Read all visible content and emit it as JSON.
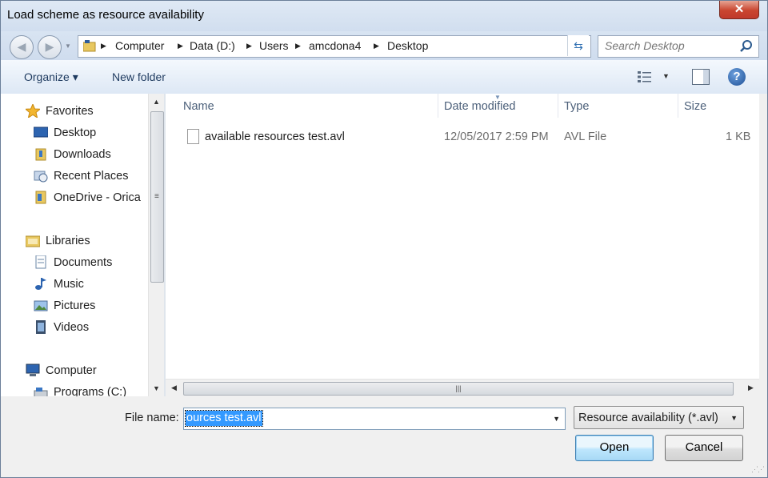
{
  "window": {
    "title": "Load scheme as resource availability",
    "close_glyph": "✕"
  },
  "navigation": {
    "back_glyph": "◀",
    "forward_glyph": "▶"
  },
  "address": {
    "breadcrumb": [
      "Computer",
      "Data (D:)",
      "Users",
      "amcdona4",
      "Desktop"
    ]
  },
  "search": {
    "placeholder": "Search Desktop"
  },
  "toolbar": {
    "organize_label": "Organize ▾",
    "new_folder_label": "New folder",
    "help_glyph": "?"
  },
  "nav_pane": {
    "favorites": {
      "label": "Favorites",
      "items": [
        "Desktop",
        "Downloads",
        "Recent Places",
        "OneDrive - Orica"
      ]
    },
    "libraries": {
      "label": "Libraries",
      "items": [
        "Documents",
        "Music",
        "Pictures",
        "Videos"
      ]
    },
    "computer": {
      "label": "Computer",
      "items": [
        "Programs (C:)"
      ]
    }
  },
  "file_list": {
    "columns": [
      "Name",
      "Date modified",
      "Type",
      "Size"
    ],
    "rows": [
      {
        "name": "available resources test.avl",
        "date_modified": "12/05/2017 2:59 PM",
        "type": "AVL File",
        "size": "1 KB"
      }
    ]
  },
  "footer": {
    "file_name_label": "File name:",
    "file_name_value": "ources test.avl",
    "file_type_value": "Resource availability (*.avl)",
    "open_label": "Open",
    "cancel_label": "Cancel"
  },
  "colors": {
    "accent": "#3399ff",
    "header_text": "#4c607a",
    "close_red": "#c9452f"
  }
}
